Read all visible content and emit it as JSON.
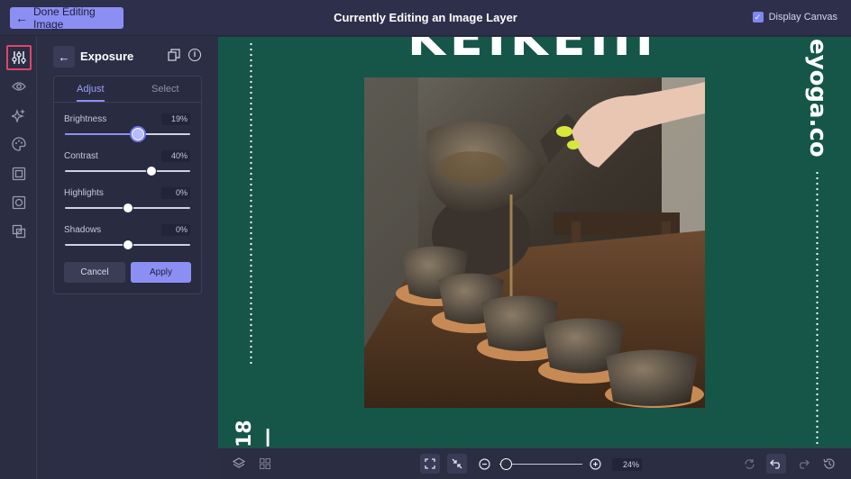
{
  "topbar": {
    "done_label": "Done Editing Image",
    "title": "Currently Editing an Image Layer",
    "display_canvas_label": "Display Canvas",
    "display_canvas_checked": true
  },
  "iconbar": {
    "items": [
      "adjust-sliders-icon",
      "eye-icon",
      "sparkle-icon",
      "palette-icon",
      "frame-icon",
      "mask-icon",
      "layer-blend-icon"
    ],
    "active": "adjust-sliders-icon"
  },
  "panel": {
    "title": "Exposure",
    "tabs": [
      {
        "label": "Adjust",
        "active": true
      },
      {
        "label": "Select",
        "active": false
      }
    ],
    "sliders": [
      {
        "label": "Brightness",
        "value_text": "19%",
        "value": 19
      },
      {
        "label": "Contrast",
        "value_text": "40%",
        "value": 40
      },
      {
        "label": "Highlights",
        "value_text": "0%",
        "value": 0
      },
      {
        "label": "Shadows",
        "value_text": "0%",
        "value": 0
      }
    ],
    "cancel_label": "Cancel",
    "apply_label": "Apply"
  },
  "canvas": {
    "headline": "KEIKEIII",
    "side_text": "eyoga.co",
    "vertical_number": "18—",
    "background": "#155649"
  },
  "bottombar": {
    "zoom_text": "24%",
    "zoom_value": 24
  },
  "colors": {
    "accent": "#8b8ff3",
    "highlight_border": "#e0446b"
  }
}
